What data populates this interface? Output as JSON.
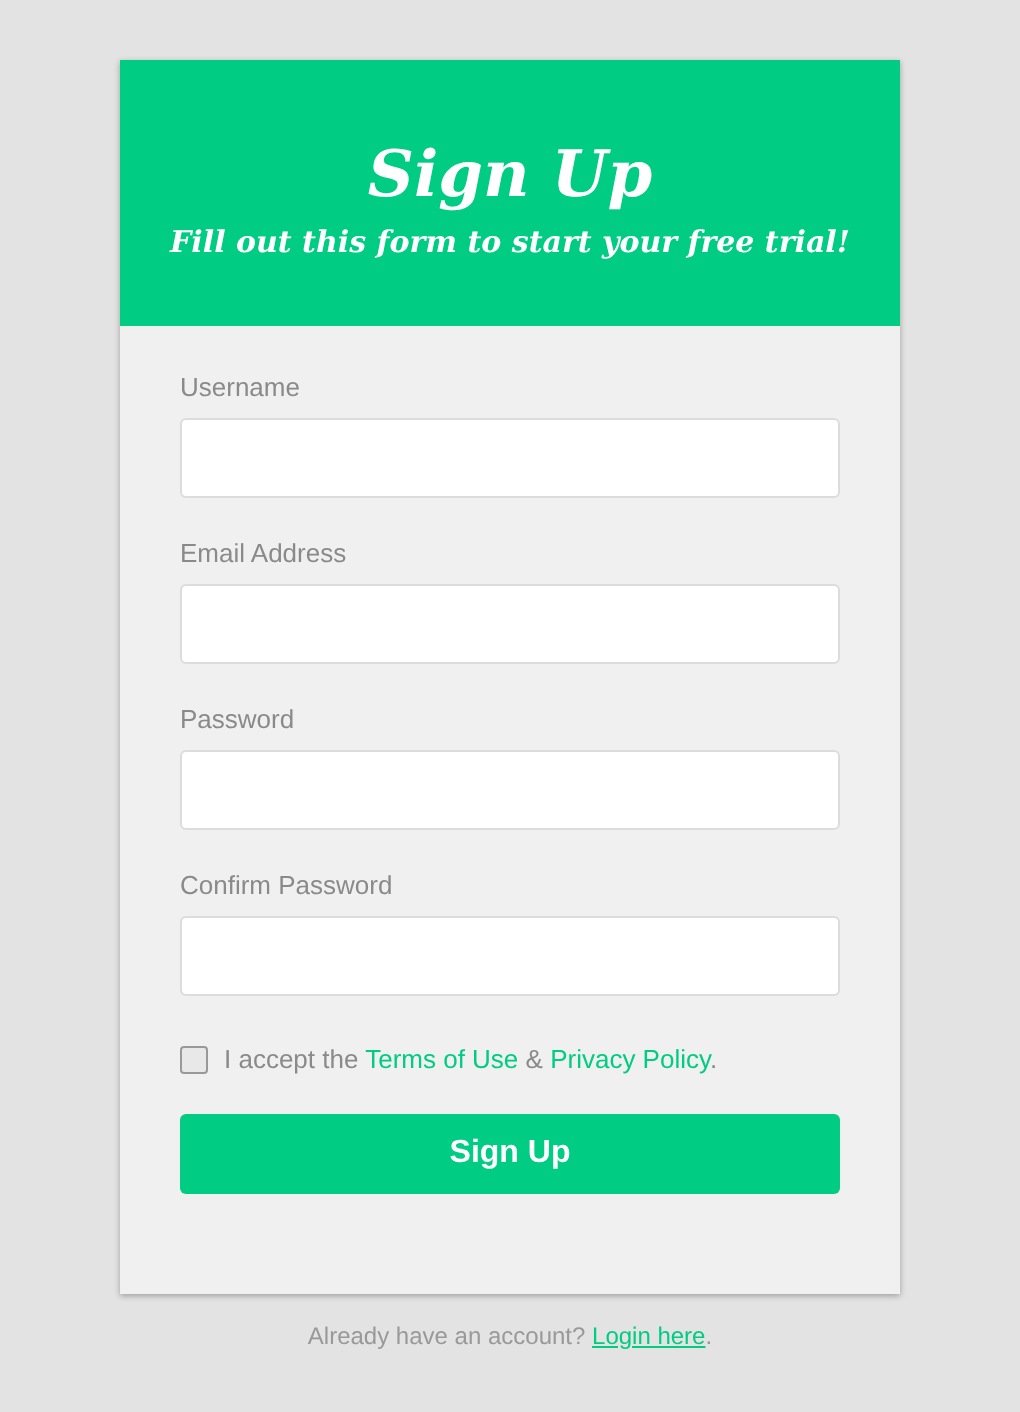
{
  "header": {
    "title": "Sign Up",
    "subtitle": "Fill out this form to start your free trial!"
  },
  "fields": [
    {
      "label": "Username"
    },
    {
      "label": "Email Address"
    },
    {
      "label": "Password"
    },
    {
      "label": "Confirm Password"
    }
  ],
  "terms": {
    "checked": false,
    "parts": [
      {
        "kind": "text",
        "text": "I accept the "
      },
      {
        "kind": "link",
        "text": "Terms of Use"
      },
      {
        "kind": "text",
        "text": " & "
      },
      {
        "kind": "link",
        "text": "Privacy Policy"
      },
      {
        "kind": "text",
        "text": "."
      }
    ]
  },
  "submit": "Sign Up",
  "footer": {
    "parts": [
      {
        "kind": "text",
        "text": "Already have an account? "
      },
      {
        "kind": "underlined-link",
        "text": "Login here"
      },
      {
        "kind": "text",
        "text": "."
      }
    ]
  }
}
